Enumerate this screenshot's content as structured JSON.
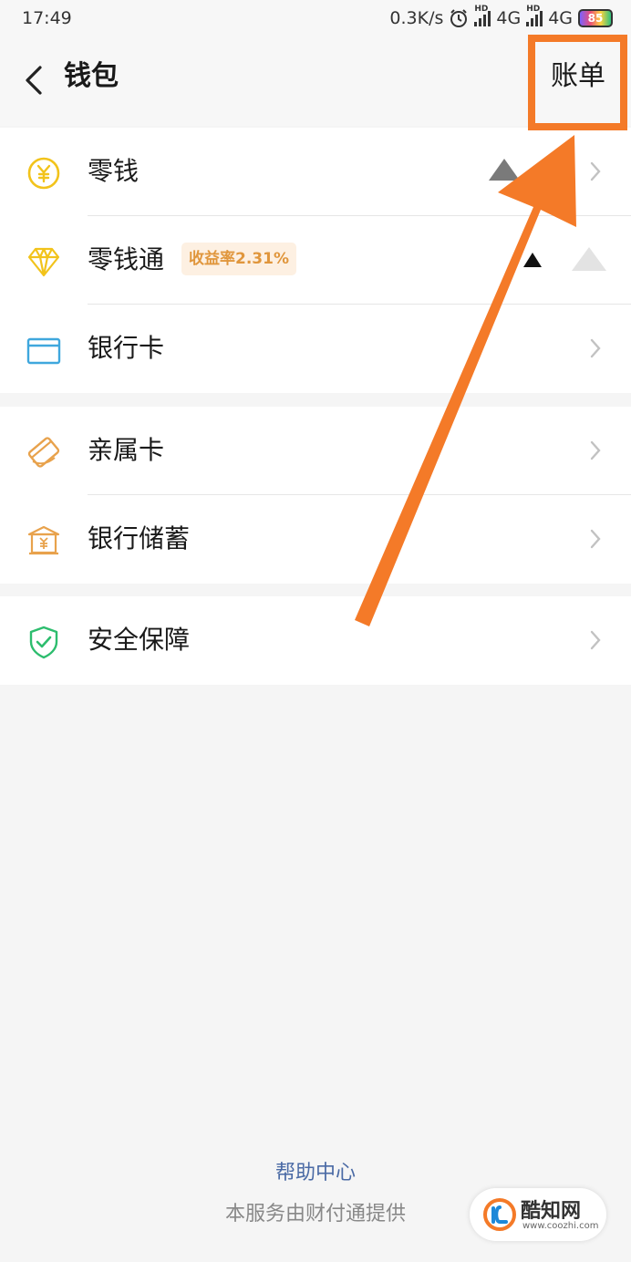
{
  "status_bar": {
    "time": "17:49",
    "network_speed": "0.3K/s",
    "alarm_icon": "alarm-clock-icon",
    "sim1_label": "4G",
    "sim2_label": "4G",
    "hd_label": "HD",
    "battery_level": "85"
  },
  "nav": {
    "back_icon": "chevron-left-icon",
    "title": "钱包",
    "bill_label": "账单"
  },
  "groups": [
    {
      "items": [
        {
          "label": "零钱",
          "icon": "yuan-coin-icon"
        },
        {
          "label": "零钱通",
          "icon": "diamond-icon",
          "badge": "收益率2.31%"
        },
        {
          "label": "银行卡",
          "icon": "bank-card-icon"
        }
      ]
    },
    {
      "items": [
        {
          "label": "亲属卡",
          "icon": "family-card-icon"
        },
        {
          "label": "银行储蓄",
          "icon": "bank-building-icon"
        }
      ]
    },
    {
      "items": [
        {
          "label": "安全保障",
          "icon": "shield-check-icon"
        }
      ]
    }
  ],
  "footer": {
    "help_center": "帮助中心",
    "provider": "本服务由财付通提供"
  },
  "watermark": {
    "name": "酷知网",
    "url": "www.coozhi.com"
  },
  "colors": {
    "annotation_orange": "#f47a28",
    "link_blue": "#4a6aa5",
    "badge_text": "#e0963c",
    "badge_bg": "#fdf0e2",
    "icon_yellow": "#f2c31b",
    "icon_blue": "#3fa7dd",
    "icon_orange": "#e8a24c",
    "icon_green": "#2dbd6e"
  }
}
